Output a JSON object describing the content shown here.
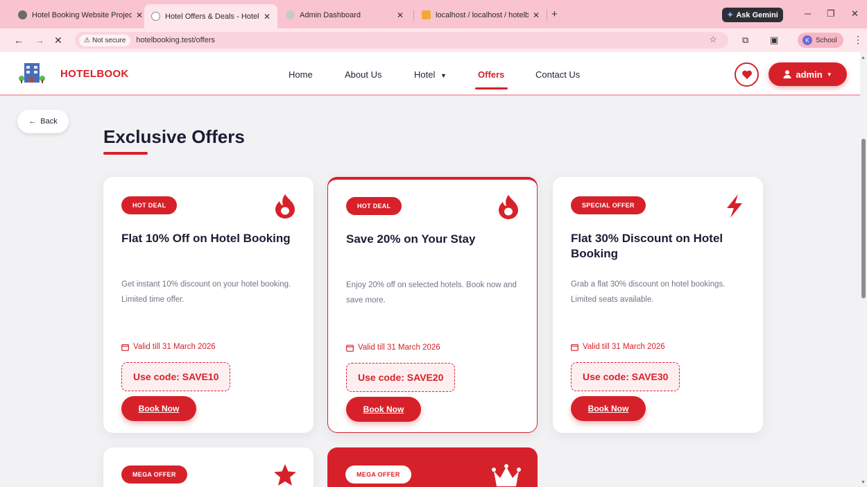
{
  "browser": {
    "tabs": [
      {
        "title": "Hotel Booking Website Project",
        "active": false
      },
      {
        "title": "Hotel Offers & Deals - HotelBo",
        "active": true
      },
      {
        "title": "Admin Dashboard",
        "active": false
      },
      {
        "title": "localhost / localhost / hotelboo",
        "active": false
      }
    ],
    "ask_gemini": "Ask Gemini",
    "not_secure": "Not secure",
    "url": "hotelbooking.test/offers",
    "profile_initial": "K",
    "profile_name": "School"
  },
  "site": {
    "brand": "HOTELBOOK",
    "menu": {
      "home": "Home",
      "about": "About Us",
      "hotel": "Hotel",
      "offers": "Offers",
      "contact": "Contact Us"
    },
    "user": "admin"
  },
  "page": {
    "back": "Back",
    "title": "Exclusive Offers"
  },
  "offers": [
    {
      "badge": "HOT DEAL",
      "icon": "fire-icon",
      "title": "Flat 10% Off on Hotel Booking",
      "desc": "Get instant 10% discount on your hotel booking. Limited time offer.",
      "valid": "Valid till 31 March 2026",
      "code": "Use code: SAVE10",
      "cta": "Book Now"
    },
    {
      "badge": "HOT DEAL",
      "icon": "fire-icon",
      "title": "Save 20% on Your Stay",
      "desc": "Enjoy 20% off on selected hotels. Book now and save more.",
      "valid": "Valid till 31 March 2026",
      "code": "Use code: SAVE20",
      "cta": "Book Now"
    },
    {
      "badge": "SPECIAL OFFER",
      "icon": "bolt-icon",
      "title": "Flat 30% Discount on Hotel Booking",
      "desc": "Grab a flat 30% discount on hotel bookings. Limited seats available.",
      "valid": "Valid till 31 March 2026",
      "code": "Use code: SAVE30",
      "cta": "Book Now"
    },
    {
      "badge": "MEGA OFFER",
      "icon": "star-icon"
    },
    {
      "badge": "MEGA OFFER",
      "icon": "crown-icon"
    }
  ],
  "colors": {
    "accent": "#d7212a",
    "tabbar": "#f9c4cf"
  }
}
